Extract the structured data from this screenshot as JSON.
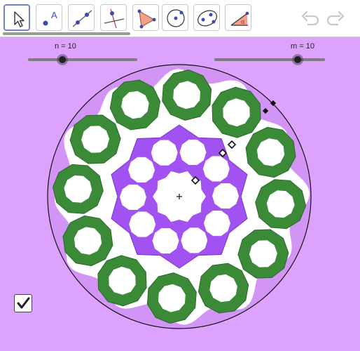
{
  "toolbar": {
    "tools": [
      {
        "name": "move-tool",
        "active": true
      },
      {
        "name": "point-tool",
        "glyph": "A"
      },
      {
        "name": "line-tool"
      },
      {
        "name": "perpendicular-line-tool"
      },
      {
        "name": "polygon-tool"
      },
      {
        "name": "circle-tool"
      },
      {
        "name": "conic-tool"
      },
      {
        "name": "angle-tool",
        "glyph": "α"
      }
    ],
    "undo_icon": "undo-icon",
    "redo_icon": "redo-icon"
  },
  "sliders": {
    "n": {
      "label": "n = 10",
      "value": 10,
      "fraction": 0.31
    },
    "m": {
      "label": "m = 10",
      "value": 10,
      "fraction": 0.76
    }
  },
  "checkbox": {
    "checked": true
  },
  "construction": {
    "big_circle": true,
    "outer_rings": 12,
    "middle_holes": 10,
    "center_marker": "+"
  },
  "colors": {
    "background": "#dda2fd",
    "ring_fill": "#3b8a37",
    "purple_polygon": "#a152f0",
    "light_purple": "#d395f5",
    "slider_track": "#7d7d7d",
    "toolbar_accent": "#6b86c9"
  }
}
